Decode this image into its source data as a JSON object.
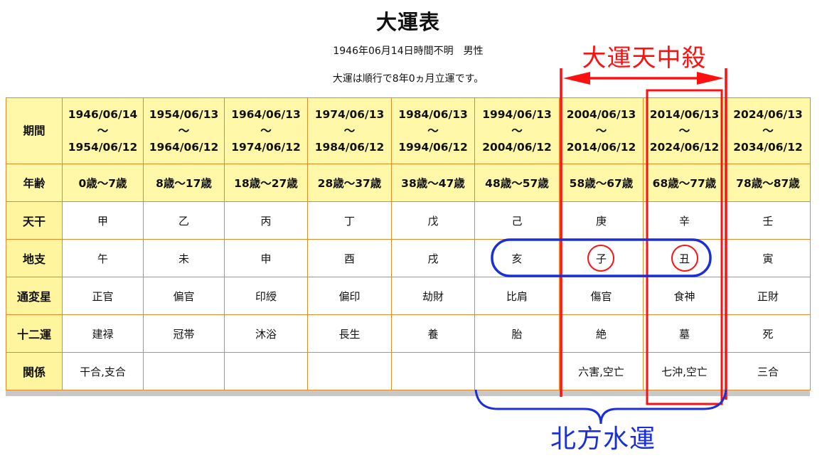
{
  "header": {
    "title": "大運表",
    "birth_info": "1946年06月14日時間不明　男性",
    "start_info": "大運は順行で8年0ヵ月立運です。"
  },
  "rows": [
    {
      "label": "期間",
      "cells": [
        [
          "1946/06/14",
          "～",
          "1954/06/12"
        ],
        [
          "1954/06/13",
          "～",
          "1964/06/12"
        ],
        [
          "1964/06/13",
          "～",
          "1974/06/12"
        ],
        [
          "1974/06/13",
          "～",
          "1984/06/12"
        ],
        [
          "1984/06/13",
          "～",
          "1994/06/12"
        ],
        [
          "1994/06/13",
          "～",
          "2004/06/12"
        ],
        [
          "2004/06/13",
          "～",
          "2014/06/12"
        ],
        [
          "2014/06/13",
          "～",
          "2024/06/12"
        ],
        [
          "2024/06/13",
          "～",
          "2034/06/12"
        ]
      ]
    },
    {
      "label": "年齢",
      "cells": [
        "0歳～7歳",
        "8歳～17歳",
        "18歳～27歳",
        "28歳～37歳",
        "38歳～47歳",
        "48歳～57歳",
        "58歳～67歳",
        "68歳～77歳",
        "78歳～87歳"
      ]
    },
    {
      "label": "天干",
      "cells": [
        "甲",
        "乙",
        "丙",
        "丁",
        "戊",
        "己",
        "庚",
        "辛",
        "壬"
      ]
    },
    {
      "label": "地支",
      "cells": [
        "午",
        "未",
        "申",
        "酉",
        "戌",
        "亥",
        "子",
        "丑",
        "寅"
      ]
    },
    {
      "label": "通変星",
      "cells": [
        "正官",
        "偏官",
        "印綬",
        "偏印",
        "劫財",
        "比肩",
        "傷官",
        "食神",
        "正財"
      ]
    },
    {
      "label": "十二運",
      "cells": [
        "建禄",
        "冠帯",
        "沐浴",
        "長生",
        "養",
        "胎",
        "絶",
        "墓",
        "死"
      ]
    },
    {
      "label": "関係",
      "cells": [
        "干合,支合",
        "",
        "",
        "",
        "",
        "",
        "六害,空亡",
        "七沖,空亡",
        "三合"
      ]
    }
  ],
  "annotations": {
    "red_label": "大運天中殺",
    "blue_label": "北方水運",
    "red_color": "#ff1010",
    "blue_color": "#1a2fd6"
  },
  "colors": {
    "header_bg": "#fff8a8",
    "border": "#e08a2a"
  }
}
